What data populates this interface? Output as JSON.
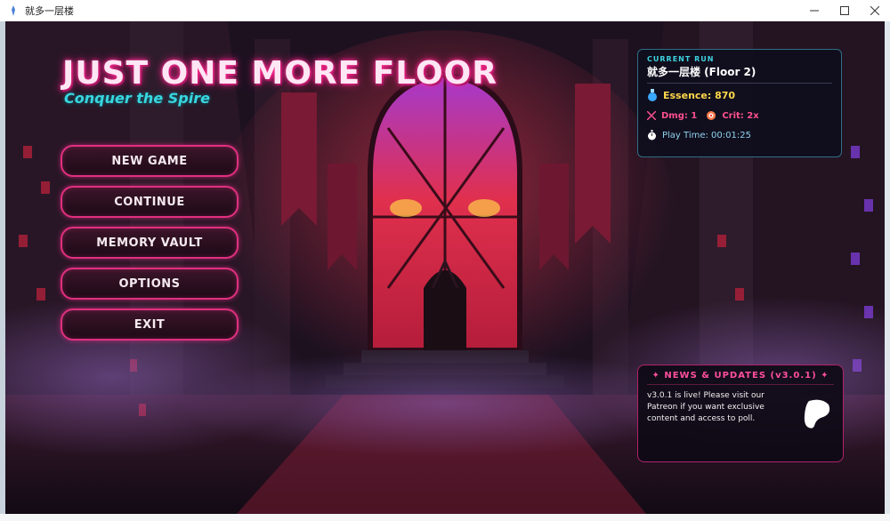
{
  "window": {
    "title": "就多一层楼",
    "controls": [
      "minimize",
      "maximize",
      "close"
    ]
  },
  "game": {
    "title": "JUST ONE MORE FLOOR",
    "subtitle": "Conquer the Spire"
  },
  "menu": {
    "items": [
      {
        "label": "NEW GAME"
      },
      {
        "label": "CONTINUE"
      },
      {
        "label": "MEMORY VAULT"
      },
      {
        "label": "OPTIONS"
      },
      {
        "label": "EXIT"
      }
    ]
  },
  "current_run": {
    "label": "CURRENT RUN",
    "title": "就多一层楼  (Floor 2)",
    "essence": "Essence: 870",
    "dmg": "Dmg: 1",
    "crit": "Crit: 2x",
    "play_time": "Play Time: 00:01:25"
  },
  "news": {
    "title": "✦ NEWS & UPDATES (v3.0.1) ✦",
    "body": "v3.0.1 is live! Please visit our Patreon if you want exclusive content and access to poll."
  },
  "colors": {
    "accent_pink": "#e0307f",
    "accent_cyan": "#39d6e0",
    "essence_gold": "#ffd84a"
  },
  "icons": {
    "essence": "potion-icon",
    "dmg": "sword-icon",
    "crit": "target-icon",
    "time": "stopwatch-icon",
    "patreon": "patreon-icon"
  }
}
